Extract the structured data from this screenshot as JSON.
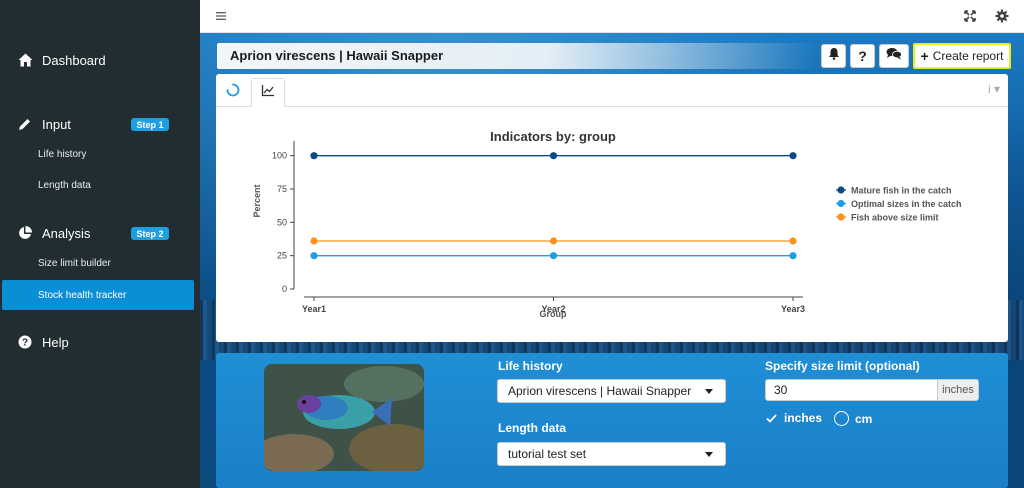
{
  "sidebar": {
    "items": [
      {
        "label": "Dashboard",
        "icon": "home-icon"
      },
      {
        "label": "Input",
        "icon": "pencil-icon",
        "badge": "Step 1",
        "children": [
          "Life history",
          "Length data"
        ]
      },
      {
        "label": "Analysis",
        "icon": "pie-chart-icon",
        "badge": "Step 2",
        "children": [
          "Size limit builder",
          "Stock health tracker"
        ]
      },
      {
        "label": "Help",
        "icon": "question-circle-icon"
      }
    ],
    "active_item": "Stock health tracker",
    "badge_color": "#1e9fe0",
    "active_color": "#0a8fd6"
  },
  "topbar": {
    "icons": [
      "hamburger-icon",
      "fullscreen-icon",
      "gear-icon"
    ]
  },
  "header": {
    "title": "Aprion virescens | Hawaii Snapper",
    "buttons": [
      "bell-icon",
      "question-icon",
      "comments-icon"
    ],
    "create_report": "Create report",
    "create_report_highlight": "#e6f01a"
  },
  "card": {
    "tabs": [
      "spinner-icon",
      "line-chart-icon"
    ],
    "info": "i"
  },
  "chart_data": {
    "type": "line",
    "title": "Indicators by: group",
    "xlabel": "Group",
    "ylabel": "Percent",
    "categories": [
      "Year1",
      "Year2",
      "Year3"
    ],
    "yticks": [
      "0",
      "25",
      "50",
      "75",
      "100"
    ],
    "ylim": [
      0,
      105
    ],
    "series": [
      {
        "name": "Mature fish in the catch",
        "values": [
          100,
          100,
          100
        ],
        "color": "#0b4a85"
      },
      {
        "name": "Optimal sizes in the catch",
        "values": [
          25,
          25,
          25
        ],
        "color": "#1e9fe0"
      },
      {
        "name": "Fish above size limit",
        "values": [
          36,
          36,
          36
        ],
        "color": "#f7931e"
      }
    ],
    "legend": "right",
    "grid": false
  },
  "panel": {
    "life_history_label": "Life history",
    "life_history_value": "Aprion virescens | Hawaii Snapper",
    "length_data_label": "Length data",
    "length_data_value": "tutorial test set",
    "size_limit_label": "Specify size limit (optional)",
    "size_limit_value": "30",
    "size_limit_unit": "inches",
    "unit_options": [
      "inches",
      "cm"
    ],
    "selected_unit": "inches"
  }
}
